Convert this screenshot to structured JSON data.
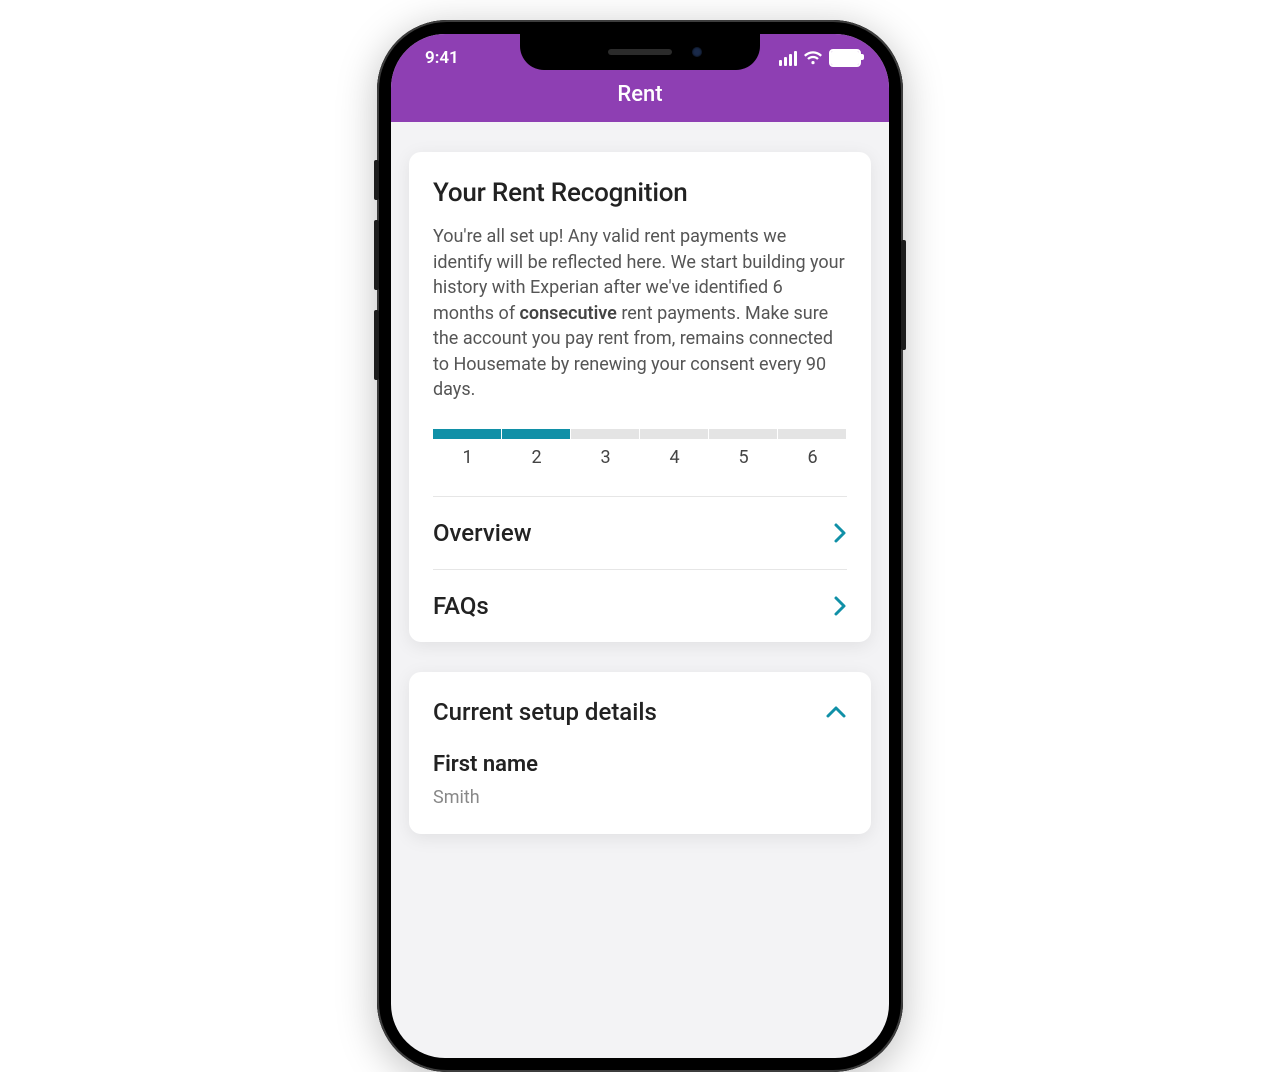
{
  "status": {
    "time": "9:41"
  },
  "header": {
    "title": "Rent"
  },
  "recognition": {
    "title": "Your Rent Recognition",
    "body_pre": "You're all set up! Any valid rent payments we identify will be reflected here. We start building your history with Experian after we've identified 6 months of ",
    "body_bold": "consecutive",
    "body_post": " rent payments. Make sure the account you pay rent from, remains connected to Housemate by renewing your consent every 90 days.",
    "progress": {
      "total": 6,
      "filled": 2,
      "labels": [
        "1",
        "2",
        "3",
        "4",
        "5",
        "6"
      ]
    },
    "links": {
      "overview": "Overview",
      "faqs": "FAQs"
    }
  },
  "setup": {
    "title": "Current setup details",
    "fields": {
      "first_name_label": "First name",
      "first_name_value": "Smith"
    }
  },
  "colors": {
    "brand": "#8e3fb3",
    "accent": "#1090a7"
  }
}
